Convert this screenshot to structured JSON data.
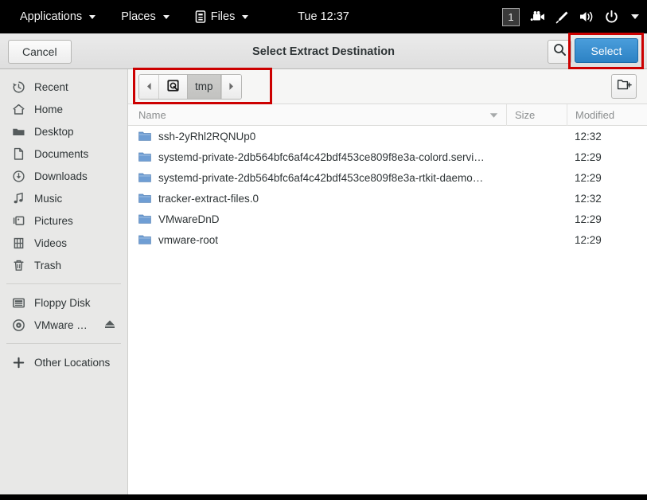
{
  "topbar": {
    "menus": [
      {
        "label": "Applications",
        "icon": "",
        "caret": true
      },
      {
        "label": "Places",
        "icon": "",
        "caret": true
      },
      {
        "label": "Files",
        "icon": "files-icon",
        "caret": true
      }
    ],
    "clock": "Tue 12:37",
    "workspace": "1",
    "tray": [
      {
        "name": "workspace-indicator",
        "glyph": "1"
      },
      {
        "name": "screencast-icon",
        "glyph": "Ἲ5"
      },
      {
        "name": "pen-tool-icon",
        "glyph": "✒"
      },
      {
        "name": "volume-icon",
        "glyph": "🔊"
      },
      {
        "name": "power-icon",
        "glyph": "⏻"
      },
      {
        "name": "system-menu-caret",
        "glyph": "▾"
      }
    ]
  },
  "header": {
    "cancel_label": "Cancel",
    "title": "Select Extract Destination",
    "search_icon": "search-icon",
    "select_label": "Select"
  },
  "sidebar": {
    "items": [
      {
        "label": "Recent",
        "icon": "clock-history-icon",
        "group": 1
      },
      {
        "label": "Home",
        "icon": "home-icon",
        "group": 1
      },
      {
        "label": "Desktop",
        "icon": "desktop-folder-icon",
        "group": 1
      },
      {
        "label": "Documents",
        "icon": "document-icon",
        "group": 1
      },
      {
        "label": "Downloads",
        "icon": "download-icon",
        "group": 1
      },
      {
        "label": "Music",
        "icon": "music-note-icon",
        "group": 1
      },
      {
        "label": "Pictures",
        "icon": "pictures-icon",
        "group": 1
      },
      {
        "label": "Videos",
        "icon": "video-film-icon",
        "group": 1
      },
      {
        "label": "Trash",
        "icon": "trash-icon",
        "group": 1
      },
      {
        "label": "Floppy Disk",
        "icon": "floppy-disk-icon",
        "group": 2
      },
      {
        "label": "VMware …",
        "icon": "optical-disc-icon",
        "group": 2,
        "eject": true
      },
      {
        "label": "Other Locations",
        "icon": "plus-icon",
        "group": 3
      }
    ]
  },
  "pathbar": {
    "back_icon": "chevron-left-icon",
    "forward_icon": "chevron-right-icon",
    "root_icon": "filesystem-disk-icon",
    "crumbs": [
      {
        "label": "tmp",
        "active": true
      }
    ],
    "new_folder_icon": "new-folder-icon"
  },
  "filelist": {
    "columns": [
      "Name",
      "Size",
      "Modified"
    ],
    "sort_column": "Name",
    "sort_direction": "descending",
    "rows": [
      {
        "name": "ssh-2yRhl2RQNUp0",
        "size": "",
        "modified": "12:32",
        "icon": "folder-icon"
      },
      {
        "name": "systemd-private-2db564bfc6af4c42bdf453ce809f8e3a-colord.servi…",
        "size": "",
        "modified": "12:29",
        "icon": "folder-icon"
      },
      {
        "name": "systemd-private-2db564bfc6af4c42bdf453ce809f8e3a-rtkit-daemo…",
        "size": "",
        "modified": "12:29",
        "icon": "folder-icon"
      },
      {
        "name": "tracker-extract-files.0",
        "size": "",
        "modified": "12:32",
        "icon": "folder-icon"
      },
      {
        "name": "VMwareDnD",
        "size": "",
        "modified": "12:29",
        "icon": "folder-icon"
      },
      {
        "name": "vmware-root",
        "size": "",
        "modified": "12:29",
        "icon": "folder-icon"
      }
    ]
  },
  "annotations": {
    "highlight_color": "#cc0000",
    "highlighted_regions": [
      "select-button",
      "path-breadcrumb-bar"
    ]
  },
  "colors": {
    "accent_blue": "#2d82c4",
    "folder_blue": "#6f9ed4",
    "panel_black": "#000000",
    "sidebar_grey": "#e8e8e7"
  }
}
